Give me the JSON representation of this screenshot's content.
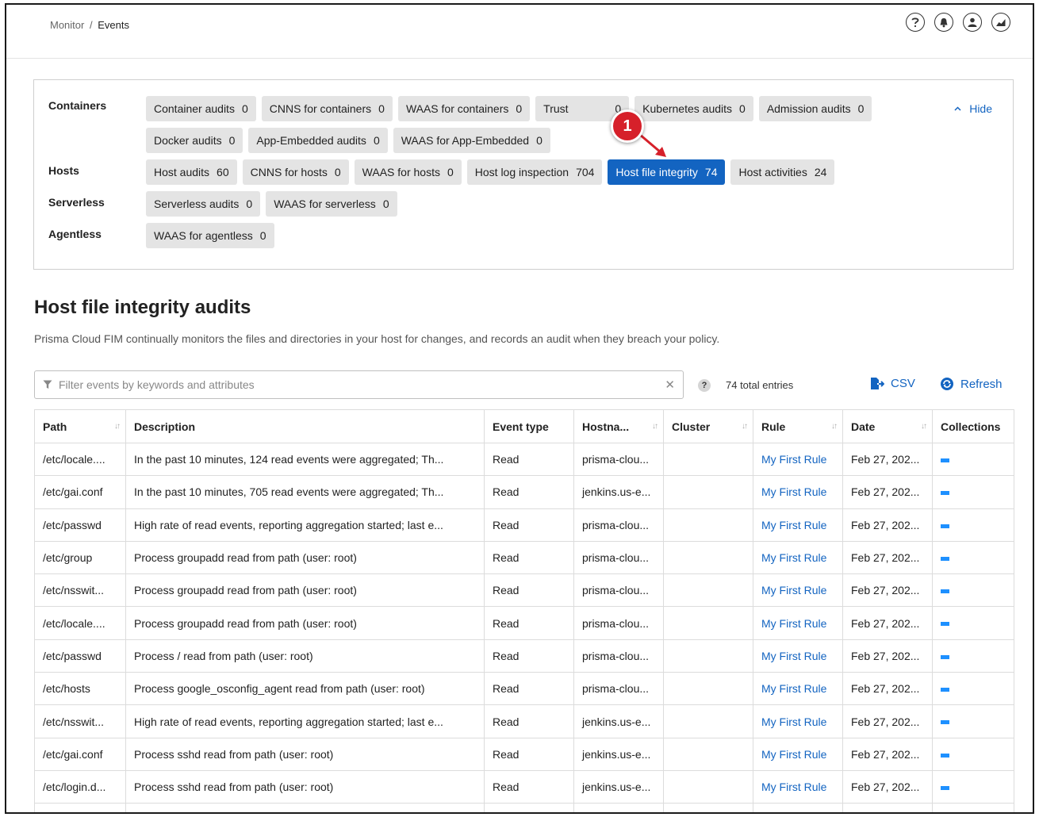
{
  "breadcrumb": {
    "parent": "Monitor",
    "separator": "/",
    "current": "Events"
  },
  "top_icons": [
    "help-icon",
    "bell-icon",
    "user-icon",
    "chart-icon"
  ],
  "filters": {
    "hide_label": "Hide",
    "groups": [
      {
        "label": "Containers",
        "rows": [
          [
            {
              "label": "Container audits",
              "count": "0"
            },
            {
              "label": "CNNS for containers",
              "count": "0"
            },
            {
              "label": "WAAS for containers",
              "count": "0"
            },
            {
              "label": "Trust",
              "count": "0"
            },
            {
              "label": "Kubernetes audits",
              "count": "0"
            },
            {
              "label": "Admission audits",
              "count": "0"
            }
          ],
          [
            {
              "label": "Docker audits",
              "count": "0"
            },
            {
              "label": "App-Embedded audits",
              "count": "0"
            },
            {
              "label": "WAAS for App-Embedded",
              "count": "0"
            }
          ]
        ]
      },
      {
        "label": "Hosts",
        "rows": [
          [
            {
              "label": "Host audits",
              "count": "60"
            },
            {
              "label": "CNNS for hosts",
              "count": "0"
            },
            {
              "label": "WAAS for hosts",
              "count": "0"
            },
            {
              "label": "Host log inspection",
              "count": "704"
            },
            {
              "label": "Host file integrity",
              "count": "74",
              "active": true
            },
            {
              "label": "Host activities",
              "count": "24"
            }
          ]
        ]
      },
      {
        "label": "Serverless",
        "rows": [
          [
            {
              "label": "Serverless audits",
              "count": "0"
            },
            {
              "label": "WAAS for serverless",
              "count": "0"
            }
          ]
        ]
      },
      {
        "label": "Agentless",
        "rows": [
          [
            {
              "label": "WAAS for agentless",
              "count": "0"
            }
          ]
        ]
      }
    ]
  },
  "annotation": {
    "number": "1",
    "color": "#d6202a"
  },
  "section": {
    "title": "Host file integrity audits",
    "description": "Prisma Cloud FIM continually monitors the files and directories in your host for changes, and records an audit when they breach your policy."
  },
  "search": {
    "placeholder": "Filter events by keywords and attributes",
    "value": ""
  },
  "entries": {
    "help": "?",
    "text": "74 total entries"
  },
  "actions": {
    "csv": "CSV",
    "refresh": "Refresh"
  },
  "colors": {
    "accent": "#1364c1",
    "active_chip": "#1364c1",
    "chip_bg": "#e4e4e4"
  },
  "table": {
    "columns": [
      {
        "label": "Path",
        "sortable": true
      },
      {
        "label": "Description",
        "sortable": false
      },
      {
        "label": "Event type",
        "sortable": false
      },
      {
        "label": "Hostna...",
        "sortable": true
      },
      {
        "label": "Cluster",
        "sortable": true
      },
      {
        "label": "Rule",
        "sortable": true
      },
      {
        "label": "Date",
        "sortable": true
      },
      {
        "label": "Collections",
        "sortable": false
      }
    ],
    "rows": [
      {
        "path": "/etc/locale....",
        "description": "In the past 10 minutes, 124 read events were aggregated; Th...",
        "event_type": "Read",
        "hostname": "prisma-clou...",
        "cluster": "",
        "rule": "My First Rule",
        "date": "Feb 27, 202..."
      },
      {
        "path": "/etc/gai.conf",
        "description": "In the past 10 minutes, 705 read events were aggregated; Th...",
        "event_type": "Read",
        "hostname": "jenkins.us-e...",
        "cluster": "",
        "rule": "My First Rule",
        "date": "Feb 27, 202..."
      },
      {
        "path": "/etc/passwd",
        "description": "High rate of read events, reporting aggregation started; last e...",
        "event_type": "Read",
        "hostname": "prisma-clou...",
        "cluster": "",
        "rule": "My First Rule",
        "date": "Feb 27, 202..."
      },
      {
        "path": "/etc/group",
        "description": "Process groupadd read from path (user: root)",
        "event_type": "Read",
        "hostname": "prisma-clou...",
        "cluster": "",
        "rule": "My First Rule",
        "date": "Feb 27, 202..."
      },
      {
        "path": "/etc/nsswit...",
        "description": "Process groupadd read from path (user: root)",
        "event_type": "Read",
        "hostname": "prisma-clou...",
        "cluster": "",
        "rule": "My First Rule",
        "date": "Feb 27, 202..."
      },
      {
        "path": "/etc/locale....",
        "description": "Process groupadd read from path (user: root)",
        "event_type": "Read",
        "hostname": "prisma-clou...",
        "cluster": "",
        "rule": "My First Rule",
        "date": "Feb 27, 202..."
      },
      {
        "path": "/etc/passwd",
        "description": "Process / read from path (user: root)",
        "event_type": "Read",
        "hostname": "prisma-clou...",
        "cluster": "",
        "rule": "My First Rule",
        "date": "Feb 27, 202..."
      },
      {
        "path": "/etc/hosts",
        "description": "Process google_osconfig_agent read from path (user: root)",
        "event_type": "Read",
        "hostname": "prisma-clou...",
        "cluster": "",
        "rule": "My First Rule",
        "date": "Feb 27, 202..."
      },
      {
        "path": "/etc/nsswit...",
        "description": "High rate of read events, reporting aggregation started; last e...",
        "event_type": "Read",
        "hostname": "jenkins.us-e...",
        "cluster": "",
        "rule": "My First Rule",
        "date": "Feb 27, 202..."
      },
      {
        "path": "/etc/gai.conf",
        "description": "Process sshd read from path (user: root)",
        "event_type": "Read",
        "hostname": "jenkins.us-e...",
        "cluster": "",
        "rule": "My First Rule",
        "date": "Feb 27, 202..."
      },
      {
        "path": "/etc/login.d...",
        "description": "Process sshd read from path (user: root)",
        "event_type": "Read",
        "hostname": "jenkins.us-e...",
        "cluster": "",
        "rule": "My First Rule",
        "date": "Feb 27, 202..."
      },
      {
        "path": "",
        "description": "",
        "event_type": "",
        "hostname": "",
        "cluster": "",
        "rule": "",
        "date": ""
      }
    ]
  }
}
